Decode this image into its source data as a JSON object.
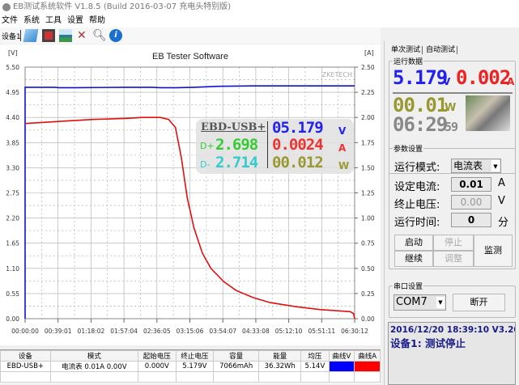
{
  "window": {
    "title": "EB测试系统软件 V1.8.5 (Build 2016-03-07 充电头特别版)"
  },
  "menu": [
    "文件",
    "系统",
    "工具",
    "设置",
    "帮助"
  ],
  "toolbar": {
    "device_label": "设备1",
    "icons": [
      "folder-icon",
      "save-icon",
      "image-icon",
      "tools-icon",
      "search-icon",
      "info-icon"
    ]
  },
  "overlay": {
    "device": "EBD-USB+",
    "dplus_label": "D+",
    "dplus": "2.698",
    "dminus_label": "D-",
    "dminus": "2.714",
    "voltage": "05.179",
    "voltage_unit": "V",
    "current": "0.0024",
    "current_unit": "A",
    "power": "00.012",
    "power_unit": "W"
  },
  "chart_data": {
    "type": "line",
    "title": "EB Tester Software",
    "watermark": "ZKETECH",
    "ylabel": "[V]",
    "y2label": "[A]",
    "ylim": [
      0,
      5.5
    ],
    "y2lim": [
      0,
      2.5
    ],
    "yticks": [
      "0.00",
      "0.55",
      "1.10",
      "1.65",
      "2.20",
      "2.75",
      "3.30",
      "3.85",
      "4.40",
      "4.95",
      "5.50"
    ],
    "y2ticks": [
      "0.00",
      "0.25",
      "0.50",
      "0.75",
      "1.00",
      "1.25",
      "1.50",
      "1.75",
      "2.00",
      "2.25",
      "2.50"
    ],
    "xticks": [
      "00:00:00",
      "00:39:01",
      "01:18:02",
      "01:57:04",
      "02:36:05",
      "03:15:06",
      "03:54:07",
      "04:33:08",
      "05:12:10",
      "05:51:11",
      "06:30:12"
    ],
    "xlim_minutes": [
      0,
      390.2
    ],
    "grid": true,
    "series": [
      {
        "name": "曲线V",
        "axis": "left",
        "color": "#1010d0",
        "x": [
          0,
          35,
          40,
          60,
          118,
          150,
          160,
          180,
          200,
          230,
          270,
          300,
          390.2
        ],
        "values": [
          5.06,
          5.06,
          5.05,
          5.05,
          5.06,
          5.06,
          5.05,
          5.05,
          5.06,
          5.08,
          5.09,
          5.09,
          5.09
        ]
      },
      {
        "name": "曲线A",
        "axis": "right",
        "color": "#e01010",
        "x": [
          0,
          20,
          39,
          80,
          118,
          140,
          160,
          170,
          178,
          185,
          192,
          200,
          210,
          220,
          235,
          250,
          270,
          290,
          320,
          350,
          385,
          389,
          390.2
        ],
        "values": [
          1.94,
          1.95,
          1.96,
          1.98,
          1.99,
          2.0,
          2.0,
          1.98,
          1.9,
          1.6,
          1.2,
          0.9,
          0.65,
          0.5,
          0.37,
          0.28,
          0.21,
          0.16,
          0.12,
          0.09,
          0.07,
          0.05,
          0.0
        ]
      }
    ]
  },
  "right_panel": {
    "tabs": [
      "单次测试",
      "自动测试"
    ],
    "run_data": {
      "label": "运行数据",
      "voltage": "5.179",
      "voltage_unit": "V",
      "current": "0.002",
      "current_unit": "A",
      "power": "00.01",
      "power_unit": "W",
      "time": "06:29",
      "seconds": "59"
    },
    "params": {
      "label": "参数设置",
      "mode_label": "运行模式:",
      "mode_value": "电流表",
      "current_label": "设定电流:",
      "current_value": "0.01",
      "current_unit": "A",
      "cutoff_label": "终止电压:",
      "cutoff_value": "0.00",
      "cutoff_unit": "V",
      "time_label": "运行时间:",
      "time_value": "0",
      "time_unit": "分",
      "start": "启动",
      "stop": "停止",
      "continue": "继续",
      "adjust": "调整",
      "monitor": "监测"
    },
    "serial": {
      "label": "串口设置",
      "port": "COM7",
      "disconnect": "断开"
    },
    "status": {
      "line1": "2016/12/20 18:39:10  V3.20",
      "line2": "设备1: 测试停止"
    }
  },
  "table": {
    "headers": [
      "设备",
      "模式",
      "起始电压",
      "终止电压",
      "容量",
      "能量",
      "均压",
      "曲线V",
      "曲线A"
    ],
    "rows": [
      [
        "EBD-USB+",
        "电流表  0.01A  0.00V",
        "0.000V",
        "5.179V",
        "7066mAh",
        "36.32Wh",
        "5.14V",
        "",
        ""
      ]
    ],
    "curve_colors": [
      "#0000ff",
      "#ff0000"
    ]
  }
}
